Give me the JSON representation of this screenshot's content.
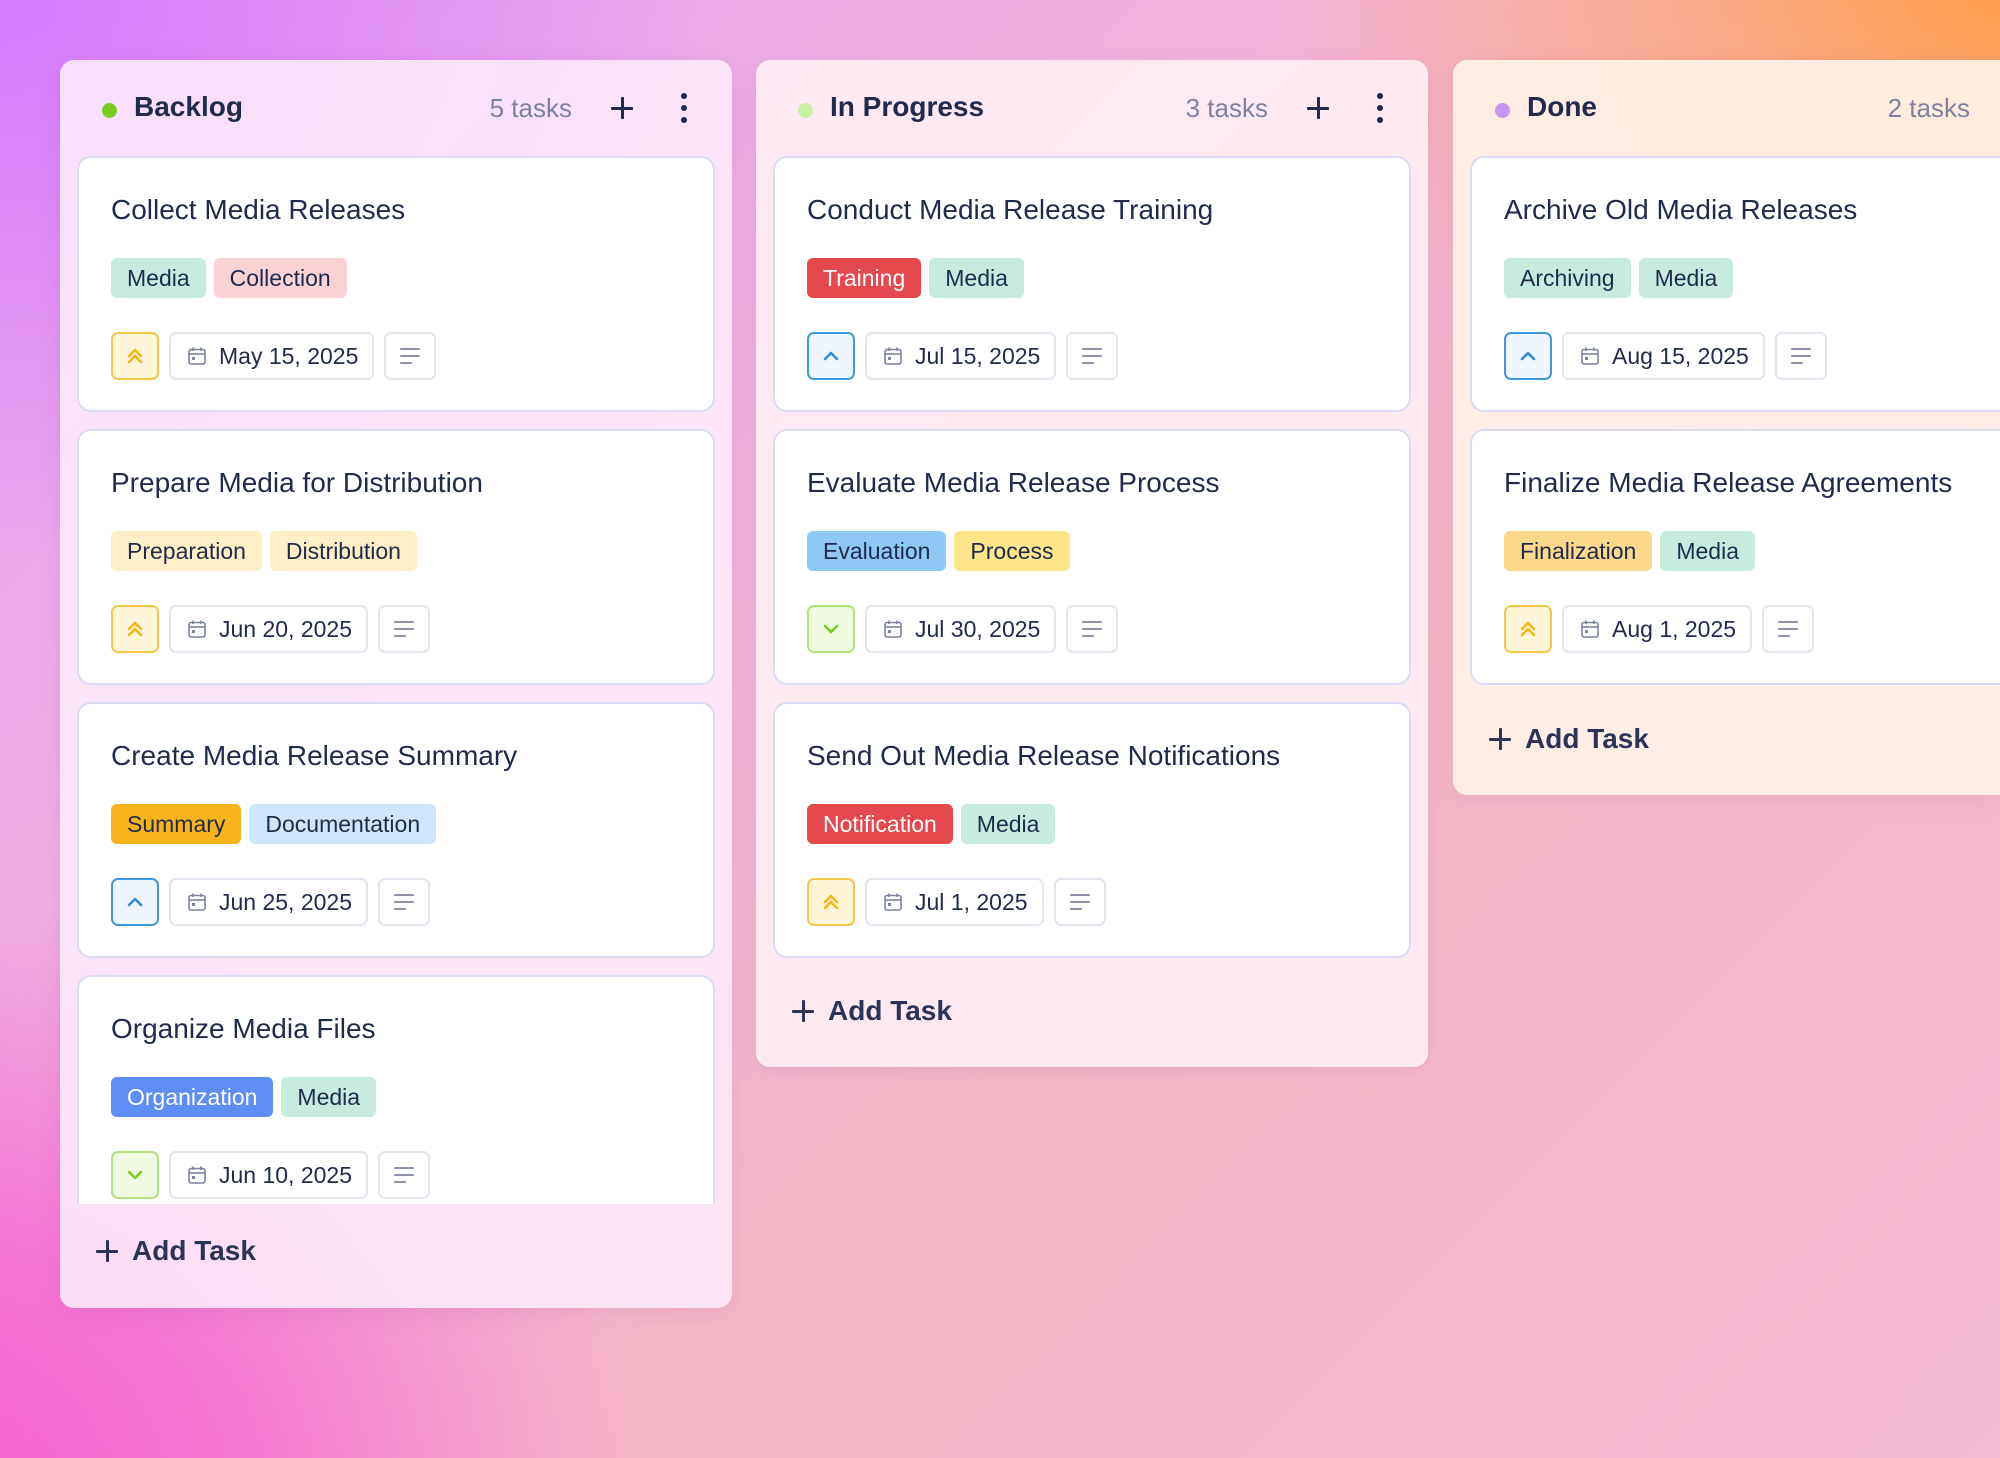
{
  "colors": {
    "backlog_dot": "#7ccd1f",
    "in_progress_dot": "#c9efa2",
    "done_dot": "#c796f2",
    "priority_high": "#f8b51a",
    "priority_medium": "#2e8ddc",
    "priority_low": "#7ccd1f"
  },
  "columns": [
    {
      "title": "Backlog",
      "count": "5 tasks",
      "dot_color": "#7ccd1f",
      "add_label": "Add Task",
      "cards": [
        {
          "title": "Collect Media Releases",
          "tags": [
            {
              "label": "Media",
              "bg": "#c7ecdf",
              "fg": "#1f2a4d"
            },
            {
              "label": "Collection",
              "bg": "#f9d2d6",
              "fg": "#1f2a4d"
            }
          ],
          "priority": "high",
          "date": "May 15, 2025"
        },
        {
          "title": "Prepare Media for Distribution",
          "tags": [
            {
              "label": "Preparation",
              "bg": "#fdefc6",
              "fg": "#1f2a4d"
            },
            {
              "label": "Distribution",
              "bg": "#fdefc6",
              "fg": "#1f2a4d"
            }
          ],
          "priority": "high",
          "date": "Jun 20, 2025"
        },
        {
          "title": "Create Media Release Summary",
          "tags": [
            {
              "label": "Summary",
              "bg": "#f9b41c",
              "fg": "#1f2a4d"
            },
            {
              "label": "Documentation",
              "bg": "#cfe6fb",
              "fg": "#1f2a4d"
            }
          ],
          "priority": "medium",
          "date": "Jun 25, 2025"
        },
        {
          "title": "Organize Media Files",
          "tags": [
            {
              "label": "Organization",
              "bg": "#5c8ef5",
              "fg": "#ffffff"
            },
            {
              "label": "Media",
              "bg": "#c7ecdf",
              "fg": "#1f2a4d"
            }
          ],
          "priority": "low",
          "date": "Jun 10, 2025"
        }
      ]
    },
    {
      "title": "In Progress",
      "count": "3 tasks",
      "dot_color": "#c9efa2",
      "add_label": "Add Task",
      "cards": [
        {
          "title": "Conduct Media Release Training",
          "tags": [
            {
              "label": "Training",
              "bg": "#e5484d",
              "fg": "#ffffff"
            },
            {
              "label": "Media",
              "bg": "#c7ecdf",
              "fg": "#1f2a4d"
            }
          ],
          "priority": "medium",
          "date": "Jul 15, 2025"
        },
        {
          "title": "Evaluate Media Release Process",
          "tags": [
            {
              "label": "Evaluation",
              "bg": "#8ec8f5",
              "fg": "#1f2a4d"
            },
            {
              "label": "Process",
              "bg": "#fde68a",
              "fg": "#1f2a4d"
            }
          ],
          "priority": "low",
          "date": "Jul 30, 2025"
        },
        {
          "title": "Send Out Media Release Notifications",
          "tags": [
            {
              "label": "Notification",
              "bg": "#e5484d",
              "fg": "#ffffff"
            },
            {
              "label": "Media",
              "bg": "#c7ecdf",
              "fg": "#1f2a4d"
            }
          ],
          "priority": "high",
          "date": "Jul 1, 2025"
        }
      ]
    },
    {
      "title": "Done",
      "count": "2 tasks",
      "dot_color": "#c796f2",
      "add_label": "Add Task",
      "cards": [
        {
          "title": "Archive Old Media Releases",
          "tags": [
            {
              "label": "Archiving",
              "bg": "#c7ecdf",
              "fg": "#1f2a4d"
            },
            {
              "label": "Media",
              "bg": "#c7ecdf",
              "fg": "#1f2a4d"
            }
          ],
          "priority": "medium",
          "date": "Aug 15, 2025"
        },
        {
          "title": "Finalize Media Release Agreements",
          "tags": [
            {
              "label": "Finalization",
              "bg": "#fcd98a",
              "fg": "#1f2a4d"
            },
            {
              "label": "Media",
              "bg": "#c7ecdf",
              "fg": "#1f2a4d"
            }
          ],
          "priority": "high",
          "date": "Aug 1, 2025"
        }
      ]
    }
  ]
}
